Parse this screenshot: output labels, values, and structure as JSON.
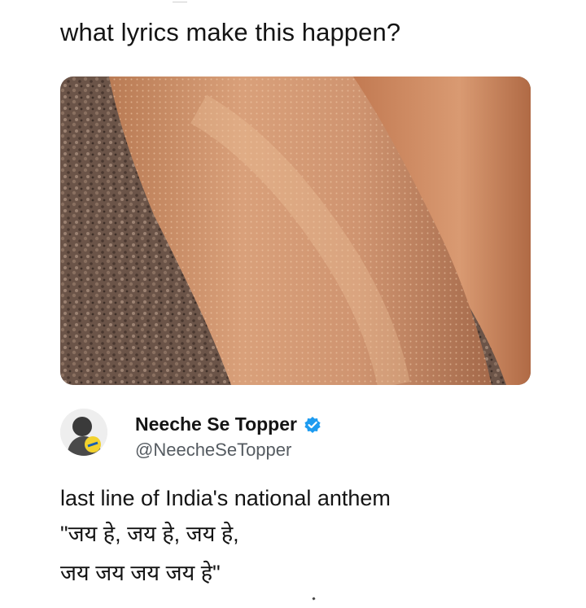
{
  "post": {
    "text": "what lyrics make this happen?"
  },
  "media": {
    "icon": "goosebumps-arm-photo"
  },
  "reply": {
    "author_name": "Neeche Se Topper",
    "handle": "@NeecheSeTopper",
    "verified": true,
    "verified_color": "#1d9bf0",
    "lines": [
      "last line of India's national anthem",
      "\"जय हे, जय हे, जय हे,",
      "जय जय जय जय हे\""
    ]
  },
  "colors": {
    "text": "#141414",
    "handle": "#555b61",
    "background": "#ffffff"
  }
}
